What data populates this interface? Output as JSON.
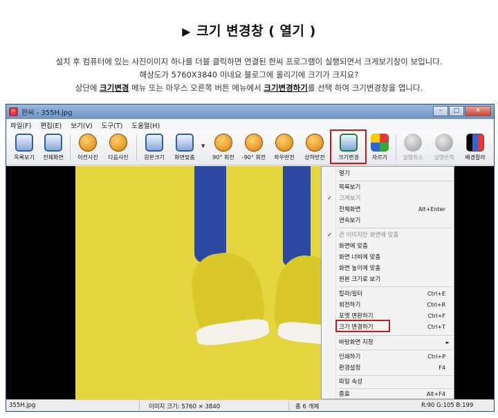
{
  "heading": {
    "marker": "▶",
    "title": "크기 변경창 ( 열기 )"
  },
  "description": {
    "line1": "설치 후 컴퓨터에 있는 사진이미지 하나를 더블 클릭하면 연결된 한씨 프로그램이 실행되면서 크게보기창이 보입니다.",
    "line2": "해상도가 5760X3840 이네요 블로그에 올리기에 크기가  크지요?",
    "line3_a": "상단에 ",
    "line3_b": "크기변경",
    "line3_c": " 메뉴  또는  마우스 오른쪽 버튼  메뉴에서 ",
    "line3_d": "크기변경하기",
    "line3_e": "를 선택 하여  크기변경창을 엽니다."
  },
  "window": {
    "title": "한씨 - 355H.jpg",
    "app_icon": "한",
    "buttons": {
      "minimize": "–",
      "maximize": "□",
      "close": "✕"
    }
  },
  "menubar": [
    "파일(F)",
    "편집(E)",
    "보기(V)",
    "도구(T)",
    "도움말(H)"
  ],
  "toolbar": [
    {
      "name": "list-view",
      "label": "목록보기",
      "icon": "monitor-icon",
      "enabled": true
    },
    {
      "name": "full-screen",
      "label": "전체화면",
      "icon": "monitor-icon",
      "enabled": true
    },
    {
      "name": "prev-photo",
      "label": "이전사진",
      "icon": "arrow-left-icon",
      "enabled": true
    },
    {
      "name": "next-photo",
      "label": "다음사진",
      "icon": "arrow-right-icon",
      "enabled": true
    },
    {
      "name": "original-size",
      "label": "원본크기",
      "icon": "monitor-icon",
      "enabled": true
    },
    {
      "name": "fit-screen",
      "label": "화면맞춤",
      "icon": "monitor-icon",
      "enabled": true
    },
    {
      "name": "rotate-90",
      "label": "90° 회전",
      "icon": "rotate-cw-icon",
      "enabled": true
    },
    {
      "name": "rotate-minus-90",
      "label": "-90° 회전",
      "icon": "rotate-ccw-icon",
      "enabled": true
    },
    {
      "name": "flip-horizontal",
      "label": "좌우반전",
      "icon": "flip-h-icon",
      "enabled": true
    },
    {
      "name": "flip-vertical",
      "label": "상하반전",
      "icon": "flip-v-icon",
      "enabled": true
    },
    {
      "name": "resize",
      "label": "크기변경",
      "icon": "resize-icon",
      "enabled": true
    },
    {
      "name": "crop",
      "label": "자르기",
      "icon": "crop-icon",
      "enabled": true
    },
    {
      "name": "undo",
      "label": "실행취소",
      "icon": "undo-icon",
      "enabled": false
    },
    {
      "name": "redo",
      "label": "실행반복",
      "icon": "redo-icon",
      "enabled": false
    },
    {
      "name": "bg-color",
      "label": "배경칼라",
      "icon": "color-swatch-icon",
      "enabled": true
    }
  ],
  "context_menu": {
    "items": [
      {
        "label": "열기",
        "shortcut": ""
      },
      {
        "label": "목록보기",
        "shortcut": ""
      },
      {
        "label": "크게보기",
        "shortcut": "",
        "checked": true,
        "dim": true,
        "check": "✓"
      },
      {
        "label": "전체화면",
        "shortcut": "Alt+Enter"
      },
      {
        "label": "연속보기",
        "shortcut": ""
      },
      {
        "label": "큰 이미지만 화면에 맞춤",
        "shortcut": "",
        "checked": true,
        "dim": true,
        "check": "✓"
      },
      {
        "label": "화면에 맞춤",
        "shortcut": ""
      },
      {
        "label": "화면 너비에 맞춤",
        "shortcut": ""
      },
      {
        "label": "화면 높이에 맞춤",
        "shortcut": ""
      },
      {
        "label": "원본 크기로 보기",
        "shortcut": ""
      },
      {
        "label": "칼라/필터",
        "shortcut": "Ctrl+E"
      },
      {
        "label": "회전하기",
        "shortcut": "Ctrl+R"
      },
      {
        "label": "포맷 변환하기",
        "shortcut": "Ctrl+F"
      },
      {
        "label": "크기 변경하기",
        "shortcut": "Ctrl+T",
        "highlighted": true
      },
      {
        "label": "바탕화면 지정",
        "shortcut": "",
        "submenu": "►"
      },
      {
        "label": "인쇄하기",
        "shortcut": "Ctrl+P"
      },
      {
        "label": "환경설정",
        "shortcut": "F4"
      },
      {
        "label": "파일 속성",
        "shortcut": ""
      },
      {
        "label": "종료",
        "shortcut": "Alt+F4"
      }
    ]
  },
  "statusbar": {
    "filename": "355H.jpg",
    "image_size": "이미지 크기: 5760 × 3840",
    "count": "총 6 개체",
    "rgb": "R:90 G:105 B:199"
  },
  "colors": {
    "highlight_border": "#c0191e",
    "photo_background": "#e5d53f",
    "pants": "#2d48a0",
    "titlebar": "#7d9dc8"
  }
}
